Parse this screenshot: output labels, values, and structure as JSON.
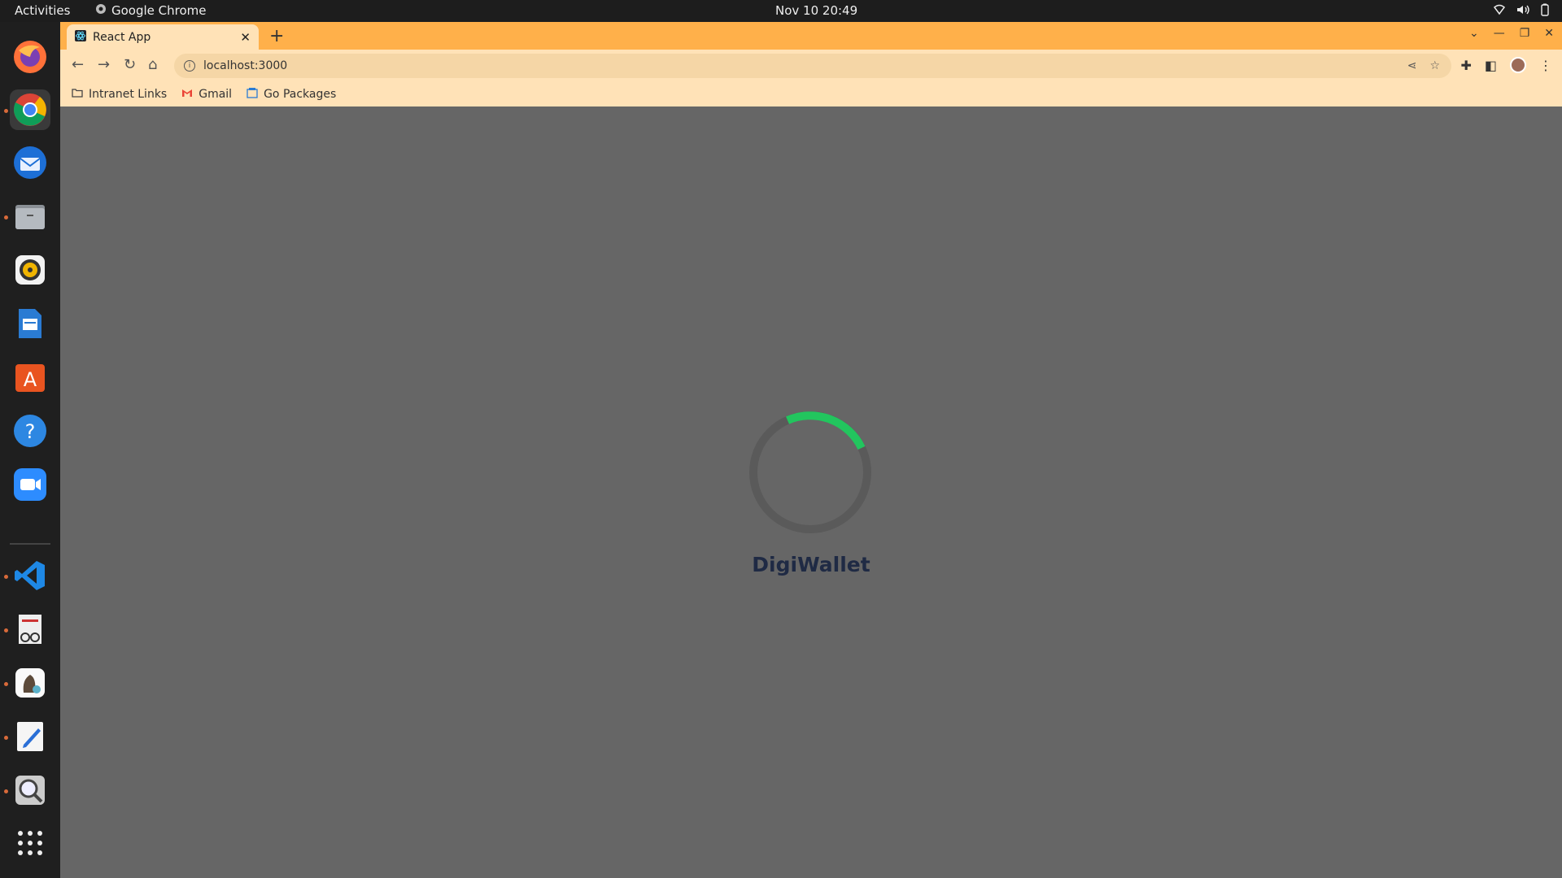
{
  "topbar": {
    "activities": "Activities",
    "app_name": "Google Chrome",
    "clock": "Nov 10  20:49"
  },
  "dock": {
    "items": [
      "firefox-icon",
      "chrome-icon",
      "thunderbird-icon",
      "files-icon",
      "rhythmbox-icon",
      "writer-icon",
      "app-center-icon",
      "help-icon",
      "zoom-icon",
      "vscode-icon",
      "document-viewer-icon",
      "gimp-icon",
      "text-editor-icon",
      "search-icon",
      "app-grid-icon"
    ]
  },
  "browser": {
    "tab_title": "React App",
    "url": "localhost:3000",
    "bookmarks": [
      "Intranet Links",
      "Gmail",
      "Go Packages"
    ]
  },
  "page": {
    "brand": "DigiWallet",
    "spinner_color": "#22c55e"
  }
}
